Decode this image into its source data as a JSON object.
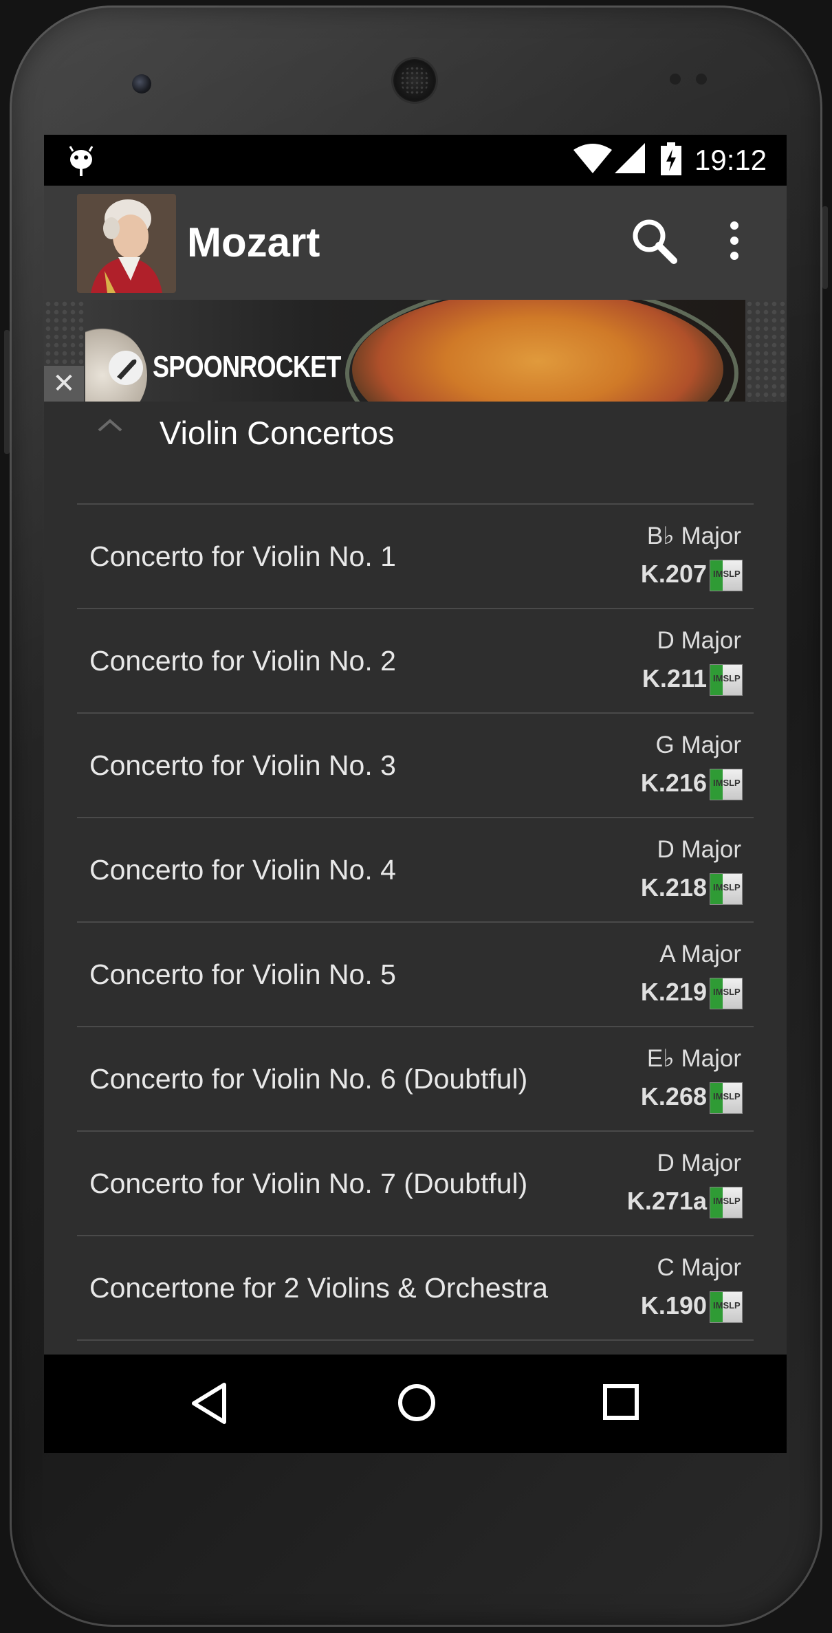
{
  "status_bar": {
    "time": "19:12",
    "icons": [
      "android-icon",
      "wifi-icon",
      "signal-icon",
      "battery-charging-icon"
    ]
  },
  "action_bar": {
    "title": "Mozart",
    "avatar": "mozart-portrait",
    "actions": [
      "search-icon",
      "overflow-menu-icon"
    ]
  },
  "ad": {
    "brand": "SPOONROCKET",
    "close_label": "✕"
  },
  "section": {
    "title": "Violin Concertos",
    "expanded": true
  },
  "works": [
    {
      "title": "Concerto for Violin No. 1",
      "key": "B♭ Major",
      "catalog": "K.207"
    },
    {
      "title": "Concerto for Violin No. 2",
      "key": "D Major",
      "catalog": "K.211"
    },
    {
      "title": "Concerto for Violin No. 3",
      "key": "G Major",
      "catalog": "K.216"
    },
    {
      "title": "Concerto for Violin No. 4",
      "key": "D Major",
      "catalog": "K.218"
    },
    {
      "title": "Concerto for Violin No. 5",
      "key": "A Major",
      "catalog": "K.219"
    },
    {
      "title": "Concerto for Violin No. 6 (Doubtful)",
      "key": "E♭ Major",
      "catalog": "K.268"
    },
    {
      "title": "Concerto for Violin No. 7 (Doubtful)",
      "key": "D Major",
      "catalog": "K.271a"
    },
    {
      "title": "Concertone for 2 Violins & Orchestra",
      "key": "C Major",
      "catalog": "K.190"
    }
  ],
  "nav_bar": {
    "buttons": [
      "back-icon",
      "home-icon",
      "recent-apps-icon"
    ]
  },
  "colors": {
    "background": "#2e2e2e",
    "action_bar": "#3b3b3b",
    "divider": "#4a4a4a",
    "imslp_green": "#2f9b35"
  }
}
